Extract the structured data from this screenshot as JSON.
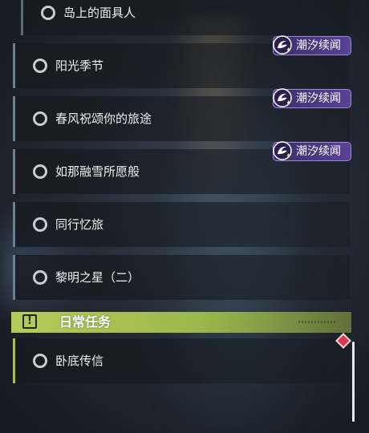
{
  "quests": [
    {
      "label": "岛上的面具人",
      "badge": null
    },
    {
      "label": "阳光季节",
      "badge": "潮汐续闻"
    },
    {
      "label": "春风祝颂你的旅途",
      "badge": "潮汐续闻"
    },
    {
      "label": "如那融雪所愿般",
      "badge": "潮汐续闻"
    },
    {
      "label": "同行忆旅",
      "badge": null
    },
    {
      "label": "黎明之星（二）",
      "badge": null
    }
  ],
  "badge_text": "潮汐续闻",
  "daily_section": {
    "title": "日常任务",
    "icon": "exclamation-box-icon",
    "items": [
      {
        "label": "卧底传信"
      }
    ]
  },
  "colors": {
    "badge_bg": "#5a4296",
    "daily_header": "#b4cc5a",
    "alert_diamond": "#d9394a"
  }
}
